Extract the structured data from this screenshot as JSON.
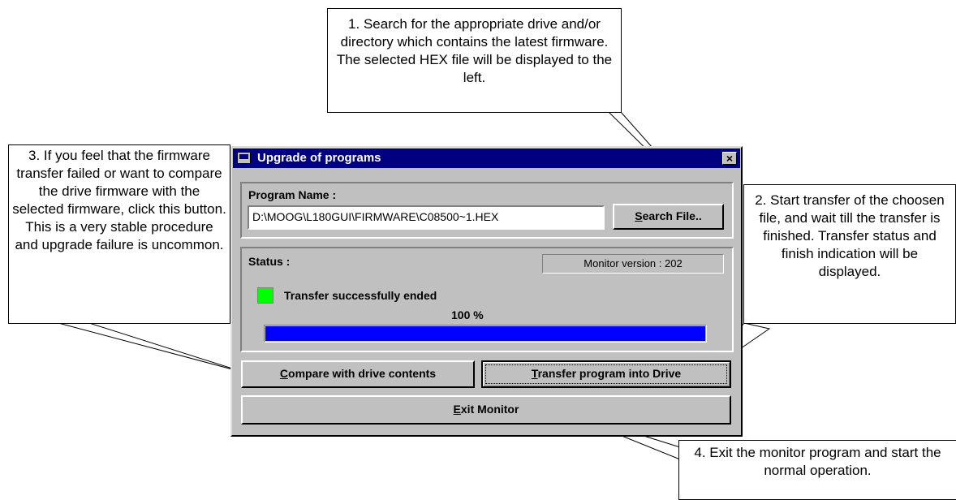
{
  "window": {
    "title": "Upgrade of programs",
    "close_glyph": "×",
    "program_name_label": "Program Name :",
    "program_path": "D:\\MOOG\\L180GUI\\FIRMWARE\\C08500~1.HEX",
    "search_button": {
      "mnemonic": "S",
      "rest": "earch File.."
    },
    "status_label": "Status :",
    "monitor_version": "Monitor version : 202",
    "status_indicator_color": "#00ff00",
    "status_message": "Transfer successfully ended",
    "progress_text": "100 %",
    "progress_value": 1.0,
    "progress_color": "#0000ff",
    "compare_button": {
      "mnemonic": "C",
      "rest": "ompare with drive contents"
    },
    "transfer_button": {
      "mnemonic": "T",
      "rest": "ransfer program into Drive"
    },
    "exit_button": {
      "mnemonic": "E",
      "rest": "xit Monitor"
    }
  },
  "callouts": {
    "search": "1. Search for the appropriate drive and/or directory which contains the latest firmware. The selected HEX file will be displayed to the left.",
    "transfer": "2. Start transfer of the choosen file, and wait till the transfer is finished. Transfer status and finish indication will be displayed.",
    "compare": "3. If you feel that the firmware transfer failed or want to compare the drive firmware with the selected  firmware, click this button. This is a very stable procedure and upgrade failure is uncommon.",
    "exit": "4. Exit the monitor program and start the normal operation."
  }
}
